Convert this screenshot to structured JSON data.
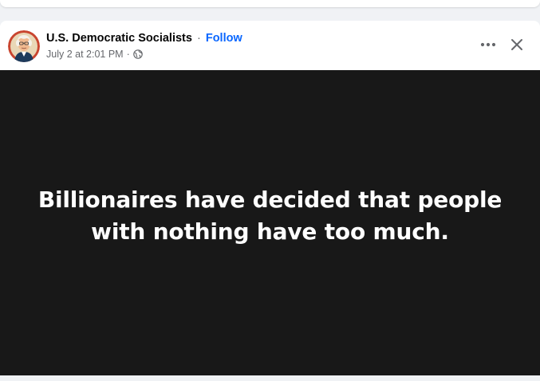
{
  "post": {
    "author": "U.S. Democratic Socialists",
    "separator": "·",
    "follow_label": "Follow",
    "timestamp": "July 2 at 2:01 PM",
    "audience_icon": "globe-icon",
    "media_text": "Billionaires have decided that people with nothing have too much."
  },
  "icons": {
    "more": "more-horizontal-icon",
    "close": "close-icon"
  },
  "colors": {
    "link": "#0866ff",
    "secondary_text": "#65676b",
    "media_background": "#181818",
    "page_background": "#f0f2f5"
  }
}
